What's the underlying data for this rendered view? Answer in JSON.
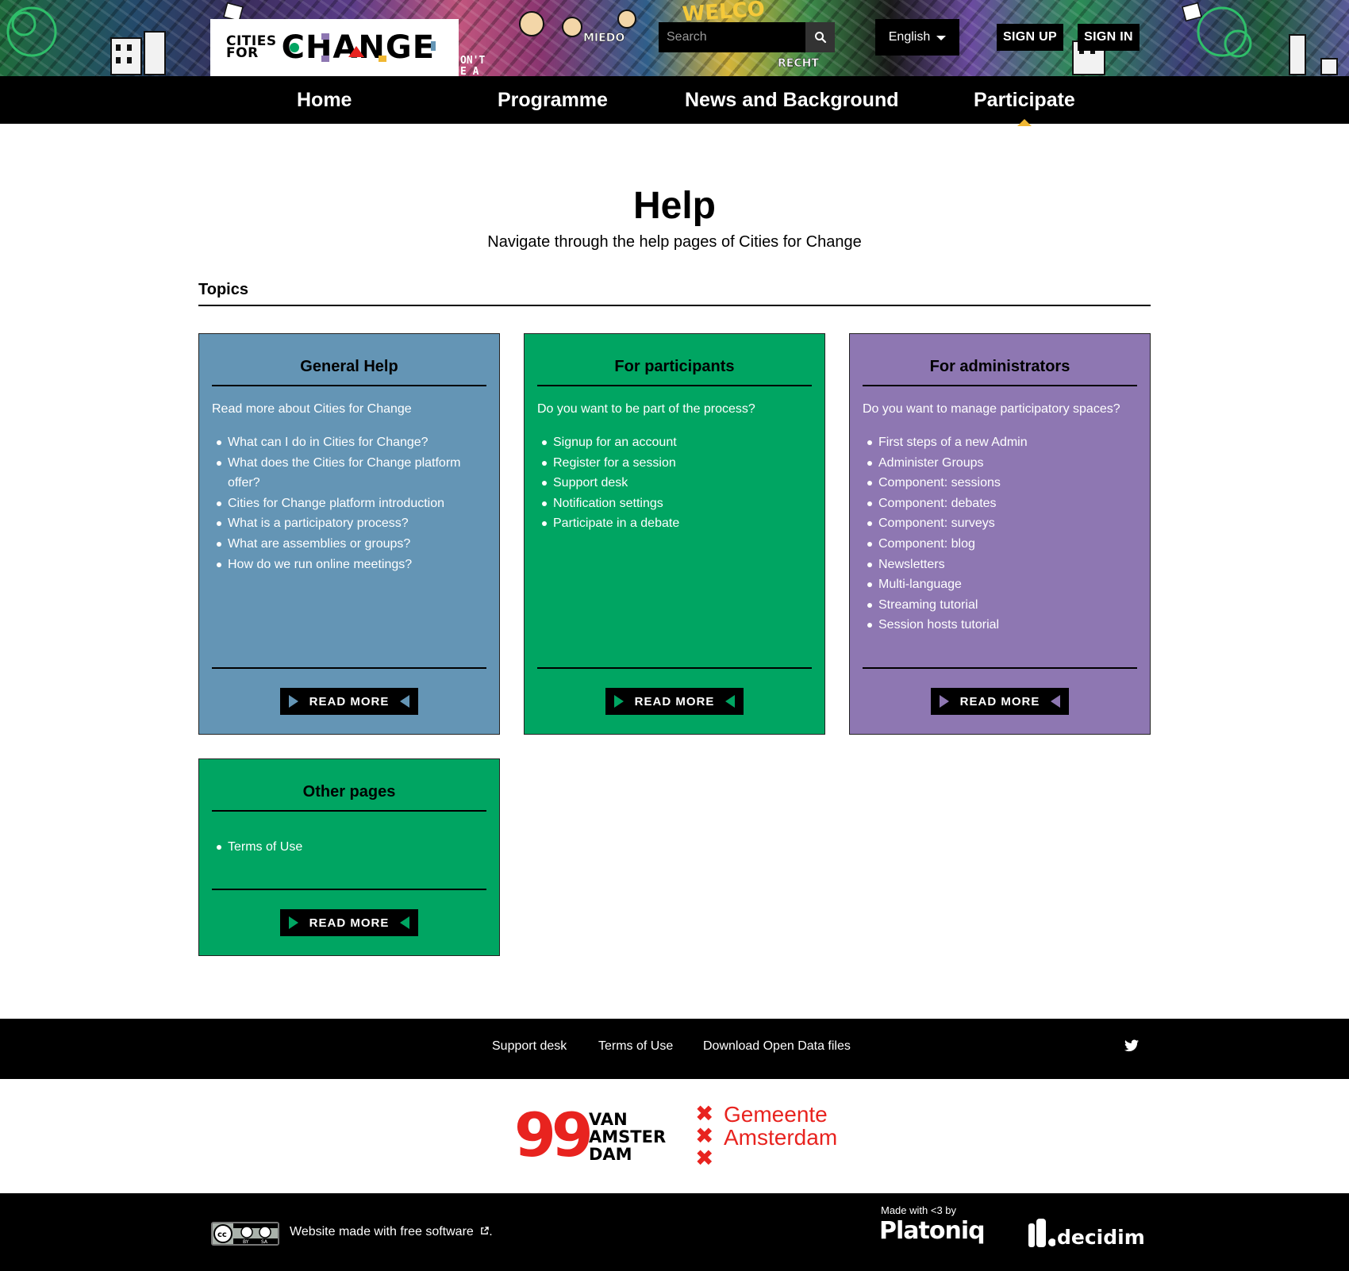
{
  "header": {
    "logo": {
      "line1": "CITIES",
      "line2": "FOR",
      "word": "CHANGE"
    },
    "search": {
      "placeholder": "Search"
    },
    "language": {
      "selected": "English"
    },
    "auth": {
      "sign_up": "SIGN UP",
      "sign_in": "SIGN IN"
    },
    "banner_words": [
      "WELCO",
      "MIEDO",
      "RECHT",
      "ON'T",
      "E A"
    ]
  },
  "nav": {
    "items": [
      {
        "label": "Home"
      },
      {
        "label": "Programme"
      },
      {
        "label": "News and Background"
      },
      {
        "label": "Participate"
      }
    ],
    "active": "Participate"
  },
  "page": {
    "title": "Help",
    "subtitle": "Navigate through the help pages of Cities for Change",
    "topics_heading": "Topics"
  },
  "cards": [
    {
      "title": "General Help",
      "color": "#6495b5",
      "description": "Read more about Cities for Change",
      "links": [
        "What can I do in Cities for Change?",
        "What does the Cities for Change platform offer?",
        "Cities for Change platform introduction",
        "What is a participatory process?",
        "What are assemblies or groups?",
        "How do we run online meetings?"
      ],
      "button": "READ MORE",
      "arrow_color": "#6495b5"
    },
    {
      "title": "For participants",
      "color": "#00a562",
      "description": "Do you want to be part of the process?",
      "links": [
        "Signup for an account",
        "Register for a session",
        "Support desk",
        "Notification settings",
        "Participate in a debate"
      ],
      "button": "READ MORE",
      "arrow_color": "#00a562"
    },
    {
      "title": "For administrators",
      "color": "#8e77b2",
      "description": "Do you want to manage participatory spaces?",
      "links": [
        "First steps of a new Admin",
        "Administer Groups",
        "Component: sessions",
        "Component: debates",
        "Component: surveys",
        "Component: blog",
        "Newsletters",
        "Multi-language",
        "Streaming tutorial",
        "Session hosts tutorial"
      ],
      "button": "READ MORE",
      "arrow_color": "#8e77b2"
    },
    {
      "title": "Other pages",
      "color": "#00a562",
      "description": "",
      "links": [
        "Terms of Use"
      ],
      "button": "READ MORE",
      "arrow_color": "#00a562"
    }
  ],
  "footer": {
    "links": [
      "Support desk",
      "Terms of Use",
      "Download Open Data files"
    ],
    "social_icon": "twitter-icon",
    "partners": {
      "p1_number": "99",
      "p1_lines": [
        "VAN",
        "AMSTER",
        "DAM"
      ],
      "p2_lines": [
        "Gemeente",
        "Amsterdam"
      ],
      "accent": "#e8231f"
    },
    "license_badge": {
      "cc": "cc",
      "by": "BY",
      "sa": "SA"
    },
    "free_software_text": "Website made with free software",
    "made_with": "Made with <3 by",
    "platoniq": "Platoniq",
    "decidim": "decidim"
  },
  "colors": {
    "nav_marker": "#f0b732",
    "header_bg": "#000000"
  }
}
